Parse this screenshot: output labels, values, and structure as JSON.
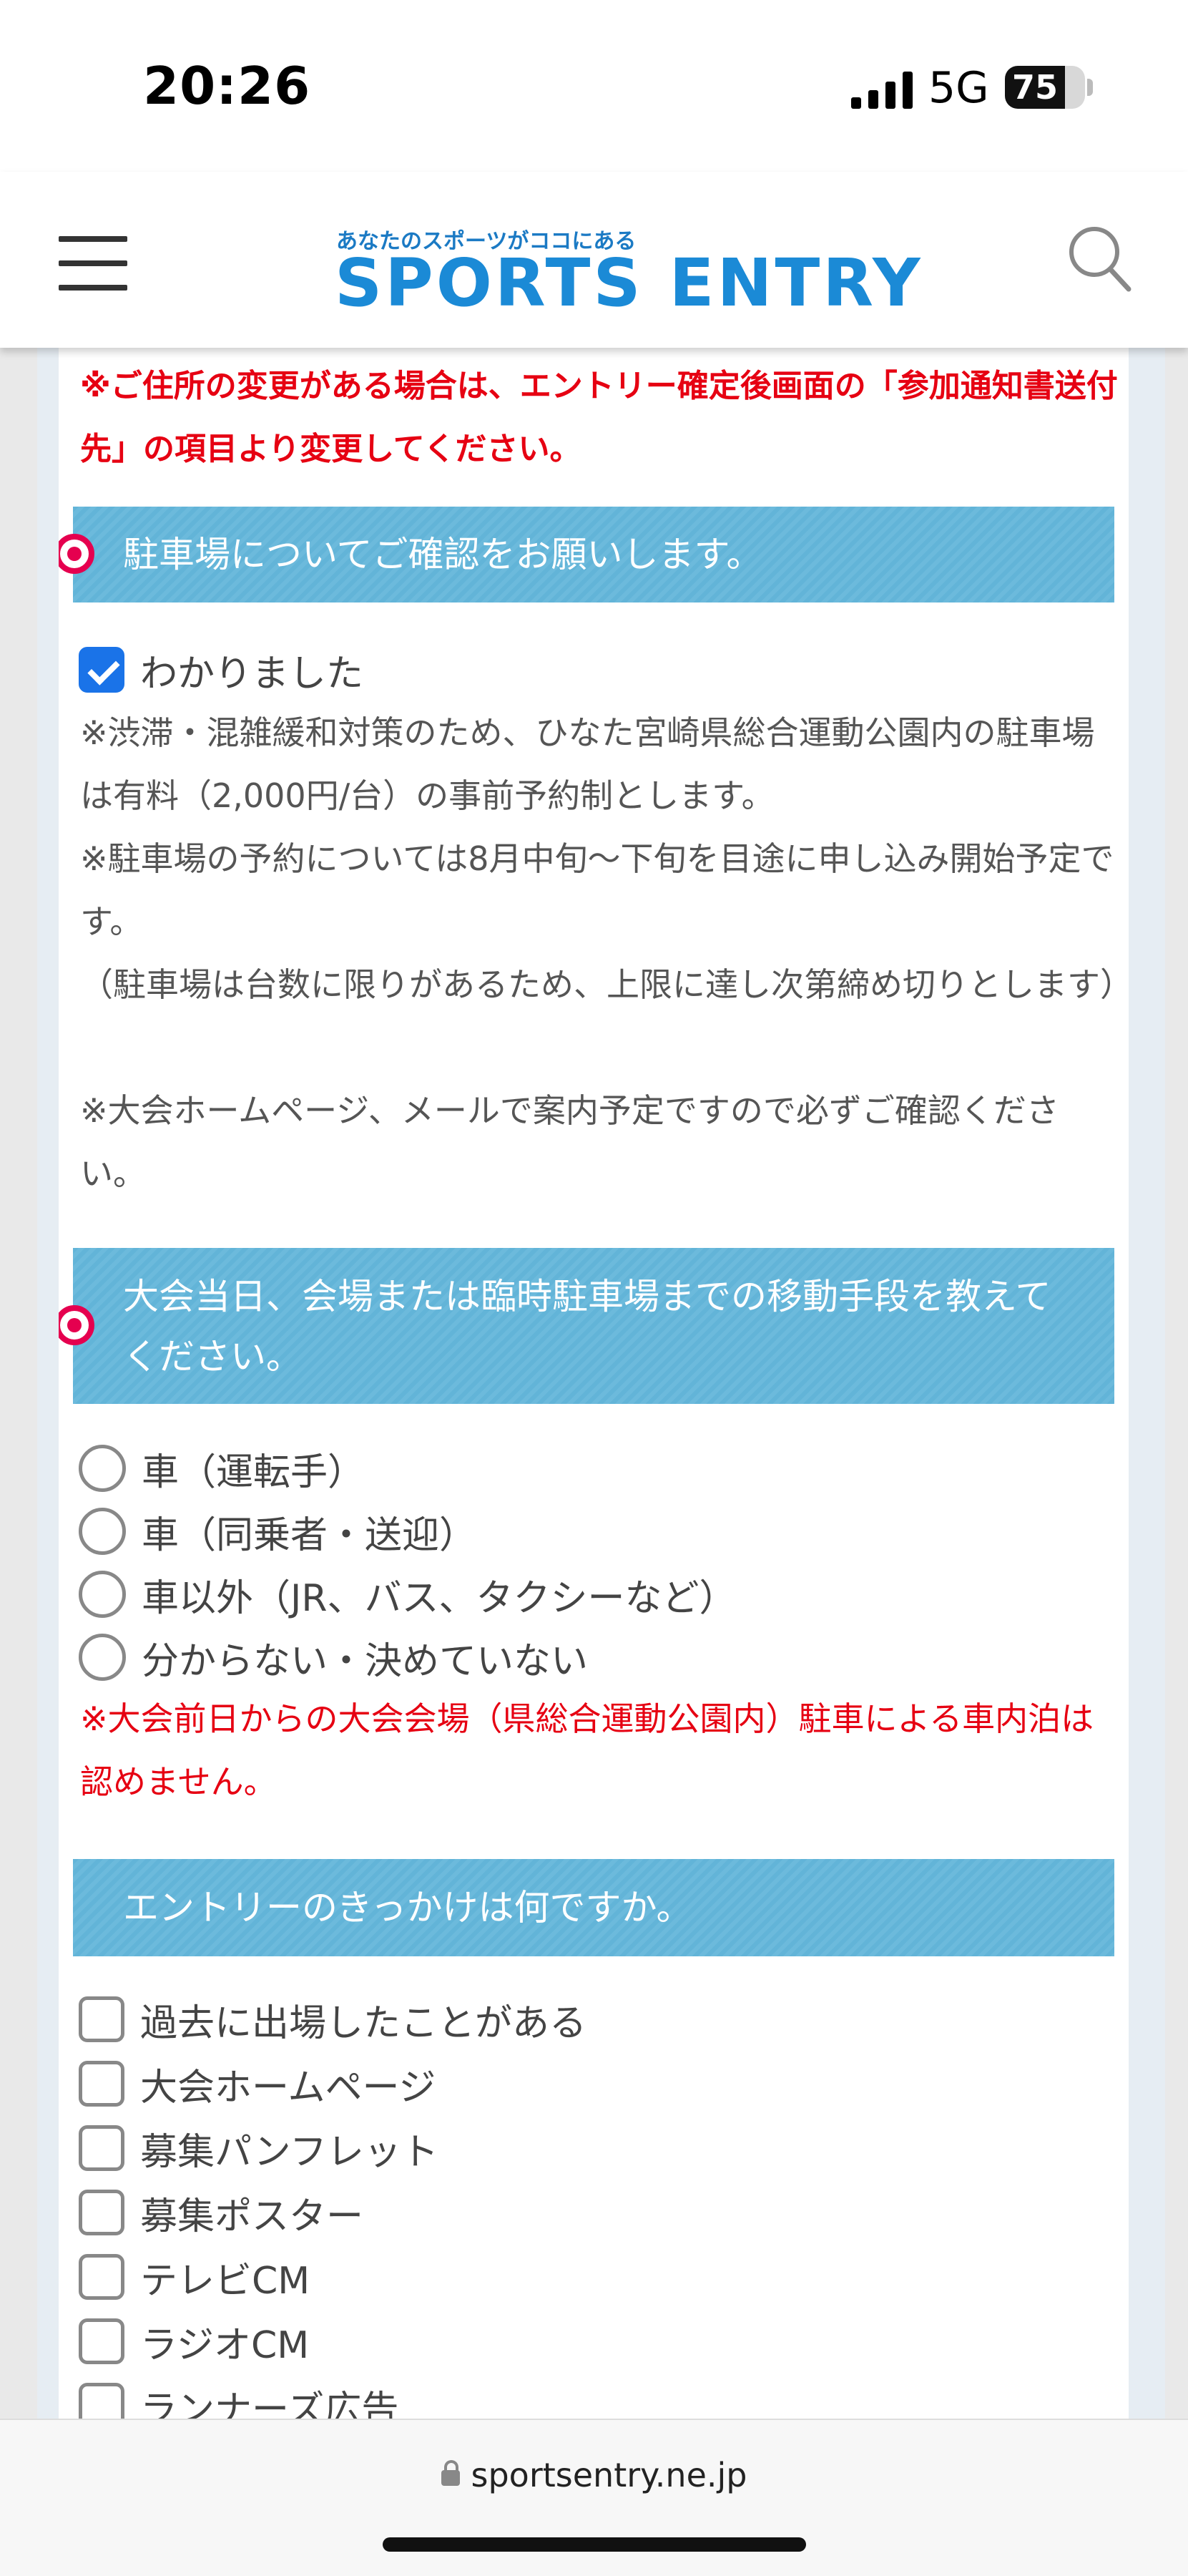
{
  "status": {
    "time": "20:26",
    "network": "5G",
    "battery": "75",
    "battery_level": 0.75
  },
  "header": {
    "logo_tagline": "あなたのスポーツがココにある",
    "logo_text": "SPORTS ENTRY"
  },
  "address_note": "※ご住所の変更がある場合は、エントリー確定後画面の「参加通知書送付先」の項目より変更してください。",
  "parking": {
    "heading": "駐車場についてご確認をお願いします。",
    "confirm_label": "わかりました",
    "confirm_checked": true,
    "notes": [
      "※渋滞・混雑緩和対策のため、ひなた宮崎県総合運動公園内の駐車場は有料（2,000円/台）の事前予約制とします。",
      "※駐車場の予約については8月中旬〜下旬を目途に申し込み開始予定です。",
      "（駐車場は台数に限りがあるため、上限に達し次第締め切りとします）",
      "※大会ホームページ、メールで案内予定ですので必ずご確認ください。"
    ]
  },
  "transport": {
    "heading": "大会当日、会場または臨時駐車場までの移動手段を教えてください。",
    "options": [
      "車（運転手）",
      "車（同乗者・送迎）",
      "車以外（JR、バス、タクシーなど）",
      "分からない・決めていない"
    ],
    "note": "※大会前日からの大会会場（県総合運動公園内）駐車による車内泊は認めません。"
  },
  "trigger": {
    "heading": "エントリーのきっかけは何ですか。",
    "options": [
      "過去に出場したことがある",
      "大会ホームページ",
      "募集パンフレット",
      "募集ポスター",
      "テレビCM",
      "ラジオCM",
      "ランナーズ広告"
    ]
  },
  "browser": {
    "url": "sportsentry.ne.jp"
  }
}
